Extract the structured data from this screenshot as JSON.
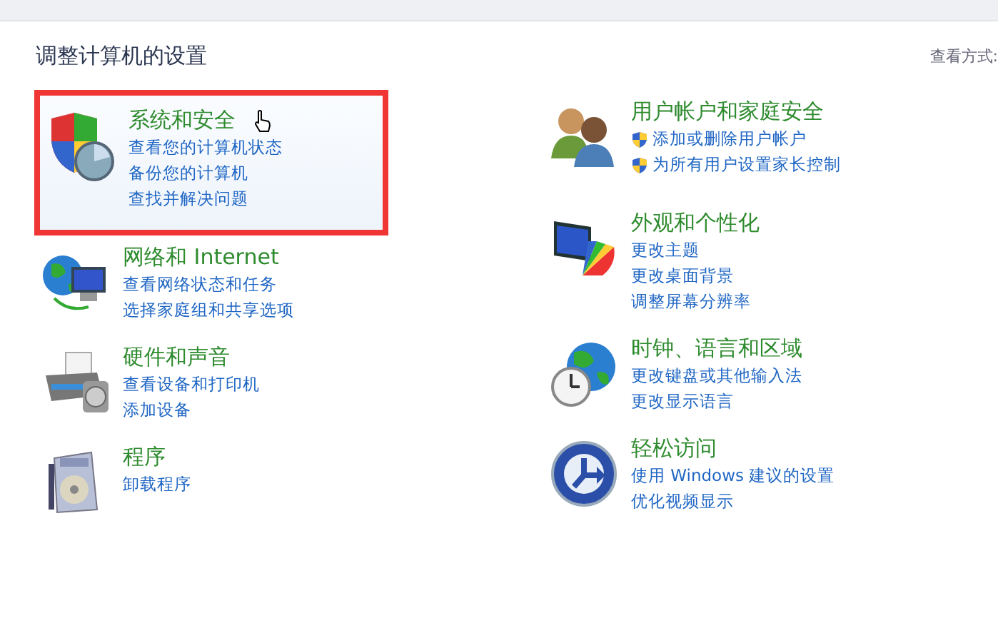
{
  "heading": "调整计算机的设置",
  "view_by": "查看方式:",
  "columns": [
    [
      {
        "title": "系统和安全",
        "highlighted": true,
        "links": [
          {
            "text": "查看您的计算机状态",
            "shield": false
          },
          {
            "text": "备份您的计算机",
            "shield": false
          },
          {
            "text": "查找并解决问题",
            "shield": false
          }
        ]
      },
      {
        "title": "网络和 Internet",
        "highlighted": false,
        "links": [
          {
            "text": "查看网络状态和任务",
            "shield": false
          },
          {
            "text": "选择家庭组和共享选项",
            "shield": false
          }
        ]
      },
      {
        "title": "硬件和声音",
        "highlighted": false,
        "links": [
          {
            "text": "查看设备和打印机",
            "shield": false
          },
          {
            "text": "添加设备",
            "shield": false
          }
        ]
      },
      {
        "title": "程序",
        "highlighted": false,
        "links": [
          {
            "text": "卸载程序",
            "shield": false
          }
        ]
      }
    ],
    [
      {
        "title": "用户帐户和家庭安全",
        "highlighted": false,
        "links": [
          {
            "text": "添加或删除用户帐户",
            "shield": true
          },
          {
            "text": "为所有用户设置家长控制",
            "shield": true
          }
        ]
      },
      {
        "title": "外观和个性化",
        "highlighted": false,
        "links": [
          {
            "text": "更改主题",
            "shield": false
          },
          {
            "text": "更改桌面背景",
            "shield": false
          },
          {
            "text": "调整屏幕分辨率",
            "shield": false
          }
        ]
      },
      {
        "title": "时钟、语言和区域",
        "highlighted": false,
        "links": [
          {
            "text": "更改键盘或其他输入法",
            "shield": false
          },
          {
            "text": "更改显示语言",
            "shield": false
          }
        ]
      },
      {
        "title": "轻松访问",
        "highlighted": false,
        "links": [
          {
            "text": "使用 Windows 建议的设置",
            "shield": false
          },
          {
            "text": "优化视频显示",
            "shield": false
          }
        ]
      }
    ]
  ]
}
